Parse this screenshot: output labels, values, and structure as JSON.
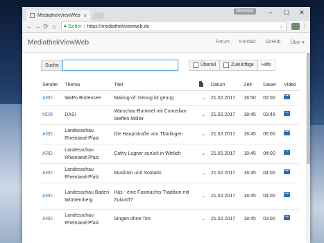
{
  "browser": {
    "tab_title": "MediathekViewWeb",
    "profile": "Benutzer",
    "secure_label": "Sicher",
    "url": "https://mediathekviewweb.de"
  },
  "site": {
    "brand": "MediathekViewWeb",
    "nav": [
      "Forum",
      "Kontakt",
      "GitHub",
      "Über ▾"
    ]
  },
  "search": {
    "label": "Suche",
    "value": "",
    "filter_overall": "Überall",
    "filter_future": "Zukünftige",
    "help": "Hilfe"
  },
  "table": {
    "headers": {
      "sender": "Sender",
      "thema": "Thema",
      "titel": "Titel",
      "datum": "Datum",
      "zeit": "Zeit",
      "dauer": "Dauer",
      "video": "Video"
    },
    "rows": [
      {
        "sender": "ARD",
        "thema": "WaPo Bodensee",
        "titel": "Making-of: Genug ist genug",
        "datum": "21.02.2017",
        "zeit": "18:50",
        "dauer": "02:00"
      },
      {
        "sender": "NDR",
        "thema": "DAS!",
        "titel": "Warschau-Bummel mit Comedian Steffen Möller",
        "datum": "21.02.2017",
        "zeit": "18:45",
        "dauer": "03:46"
      },
      {
        "sender": "ARD",
        "thema": "Landesschau Rheinland-Pfalz",
        "titel": "Die Hauptstraße von Thörlingen",
        "datum": "21.02.2017",
        "zeit": "18:45",
        "dauer": "06:00"
      },
      {
        "sender": "ARD",
        "thema": "Landesschau Rheinland-Pfalz",
        "titel": "Cathy Lugner zurück in Wittlich",
        "datum": "21.02.2017",
        "zeit": "18:45",
        "dauer": "04:00"
      },
      {
        "sender": "ARD",
        "thema": "Landesschau Rheinland-Pfalz",
        "titel": "Muslimin und Soldatin",
        "datum": "21.02.2017",
        "zeit": "18:45",
        "dauer": "04:00"
      },
      {
        "sender": "ARD",
        "thema": "Landesschau Baden-Württemberg",
        "titel": "Häs - eine Fastnachts-Tradition mit Zukunft?",
        "datum": "21.02.2017",
        "zeit": "18:45",
        "dauer": "04:00"
      },
      {
        "sender": "ARD",
        "thema": "Landesschau Rheinland-Pfalz",
        "titel": "Singen ohne Ton",
        "datum": "21.02.2017",
        "zeit": "18:45",
        "dauer": "03:00"
      }
    ]
  },
  "colors": {
    "link": "#337ab7",
    "video_icon": "#2a6fb3",
    "secure": "#1e8e3e"
  }
}
